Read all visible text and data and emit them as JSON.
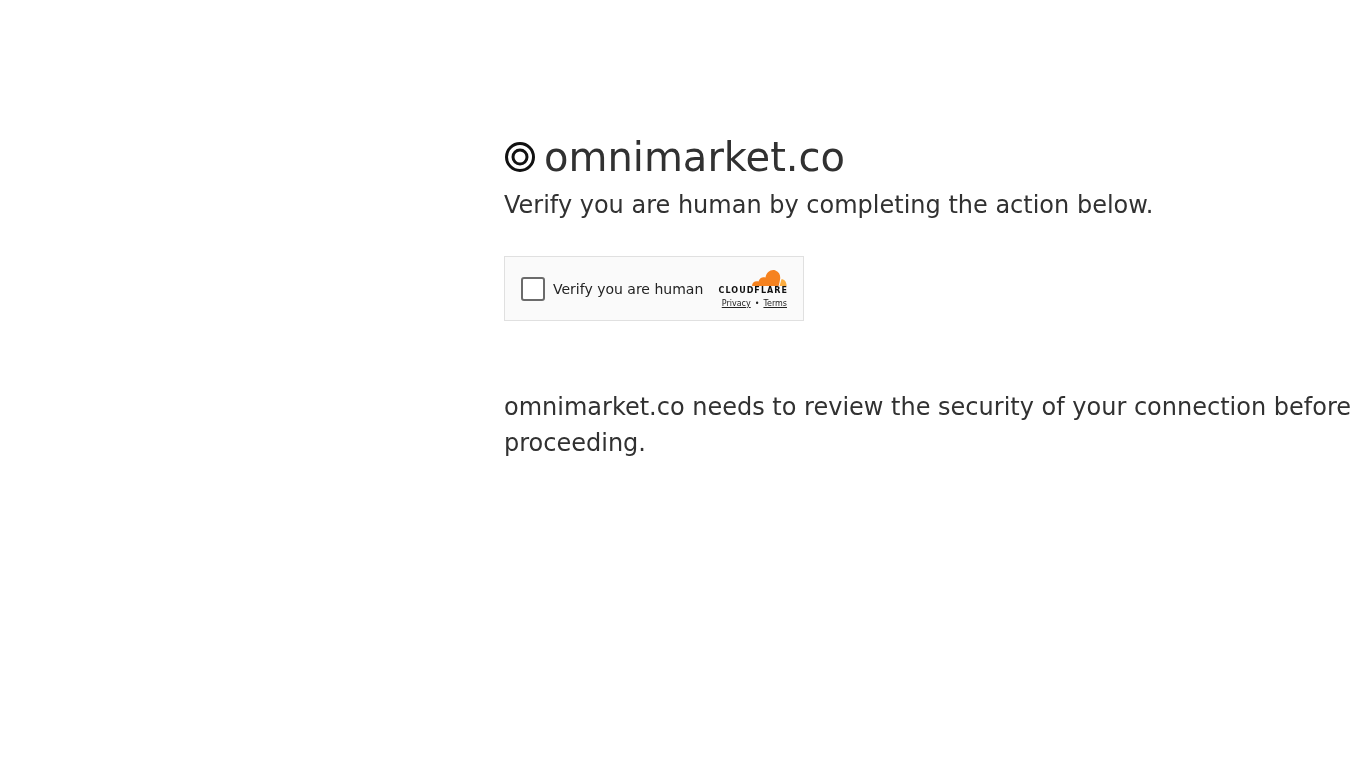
{
  "site": {
    "name": "omnimarket.co",
    "subtitle": "Verify you are human by completing the action below."
  },
  "widget": {
    "checkbox": {
      "label": "Verify you are human",
      "checked": false
    },
    "brand": "CLOUDFLARE",
    "links": [
      "Privacy",
      "Terms"
    ],
    "separator": "•"
  },
  "message": "omnimarket.co needs to review the security of your connection before proceeding."
}
